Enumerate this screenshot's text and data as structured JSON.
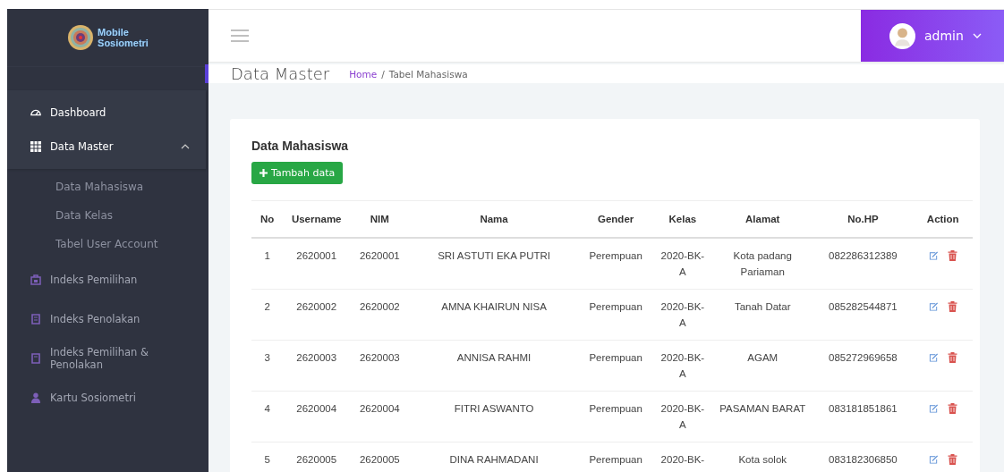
{
  "brand": {
    "line1": "Mobile",
    "line2": "Sosiometri"
  },
  "sidebar": {
    "items": [
      {
        "label": "Dashboard",
        "selected": true
      },
      {
        "label": "Data Master",
        "selected": true,
        "expanded": true,
        "children": [
          {
            "label": "Data Mahasiswa"
          },
          {
            "label": "Data Kelas"
          },
          {
            "label": "Tabel User Account"
          }
        ]
      },
      {
        "label": "Indeks Pemilihan",
        "selected": false
      },
      {
        "label": "Indeks Penolakan",
        "selected": false
      },
      {
        "label": "Indeks Pemilihan & Penolakan",
        "selected": false
      },
      {
        "label": "Kartu Sosiometri",
        "selected": false
      }
    ]
  },
  "user": {
    "name": "admin"
  },
  "page": {
    "title": "Data Master",
    "breadcrumb": [
      {
        "label": "Home"
      },
      {
        "label": "Tabel Mahasiswa"
      }
    ],
    "breadcrumb_separator": "/"
  },
  "card": {
    "title": "Data Mahasiswa",
    "add_button": "Tambah data",
    "table": {
      "columns": [
        "No",
        "Username",
        "NIM",
        "Nama",
        "Gender",
        "Kelas",
        "Alamat",
        "No.HP",
        "Action"
      ],
      "rows": [
        [
          "1",
          "2620001",
          "2620001",
          "SRI ASTUTI EKA PUTRI",
          "Perempuan",
          "2020-BK-A",
          "Kota padang Pariaman",
          "082286312389"
        ],
        [
          "2",
          "2620002",
          "2620002",
          "AMNA KHAIRUN NISA",
          "Perempuan",
          "2020-BK-A",
          "Tanah Datar",
          "085282544871"
        ],
        [
          "3",
          "2620003",
          "2620003",
          "ANNISA RAHMI",
          "Perempuan",
          "2020-BK-A",
          "AGAM",
          "085272969658"
        ],
        [
          "4",
          "2620004",
          "2620004",
          "FITRI ASWANTO",
          "Perempuan",
          "2020-BK-A",
          "PASAMAN BARAT",
          "083181851861"
        ],
        [
          "5",
          "2620005",
          "2620005",
          "DINA RAHMADANI",
          "Perempuan",
          "2020-BK-",
          "Kota solok",
          "083182306850"
        ]
      ]
    }
  }
}
